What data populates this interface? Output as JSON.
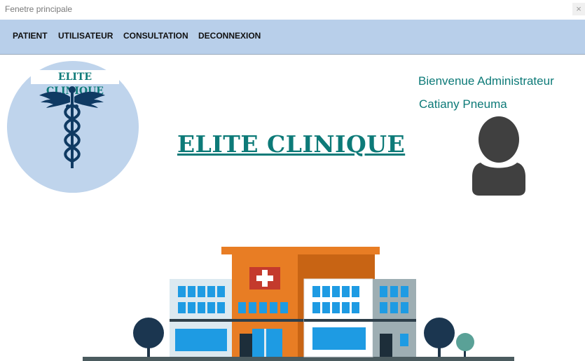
{
  "window": {
    "title": "Fenetre principale",
    "close_glyph": "×"
  },
  "menu": {
    "items": [
      {
        "label": "PATIENT"
      },
      {
        "label": "UTILISATEUR"
      },
      {
        "label": "CONSULTATION"
      },
      {
        "label": "DECONNEXION"
      }
    ]
  },
  "logo": {
    "text": "ELITE CLINIQUE",
    "icon": "caduceus-icon"
  },
  "header": {
    "title": "ELITE CLINIQUE"
  },
  "user": {
    "welcome": "Bienvenue Administrateur",
    "name": "Catiany Pneuma",
    "avatar_icon": "user-avatar-icon"
  },
  "illustration": {
    "icon": "hospital-building-illustration"
  },
  "colors": {
    "menubar": "#b8cfea",
    "accent": "#0d7a78",
    "logo_circle": "#bfd4ec",
    "avatar": "#404040"
  }
}
